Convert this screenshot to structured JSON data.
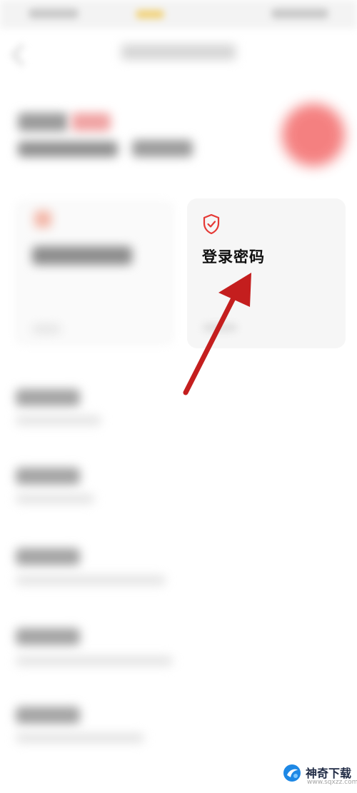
{
  "card_right": {
    "title": "登录密码",
    "icon": "shield-check-icon"
  },
  "list": {
    "items": [
      {
        "id": "setting-1"
      },
      {
        "id": "setting-2"
      },
      {
        "id": "setting-3"
      },
      {
        "id": "setting-4"
      },
      {
        "id": "setting-5"
      }
    ]
  },
  "annotation": {
    "arrow_color": "#c41e1e"
  },
  "watermark": {
    "name": "神奇下载",
    "url": "www.sqxzz.com",
    "logo": "sqxzz-logo-icon"
  },
  "colors": {
    "accent_red": "#e53935",
    "avatar_red": "#f36b6b"
  }
}
